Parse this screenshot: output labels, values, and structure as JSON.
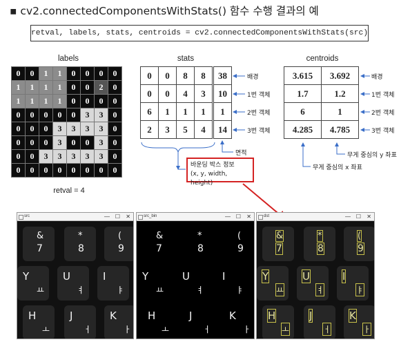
{
  "title": "▪ cv2.connectedComponentsWithStats() 함수 수행 결과의 예",
  "code": "retval, labels, stats, centroids = cv2.connectedComponentsWithStats(src)",
  "labels_caption": "labels",
  "labels_grid": [
    [
      0,
      0,
      1,
      1,
      0,
      0,
      0,
      0
    ],
    [
      1,
      1,
      1,
      1,
      0,
      0,
      2,
      0
    ],
    [
      1,
      1,
      1,
      1,
      0,
      0,
      0,
      0
    ],
    [
      0,
      0,
      0,
      0,
      0,
      3,
      3,
      0
    ],
    [
      0,
      0,
      0,
      3,
      3,
      3,
      3,
      0
    ],
    [
      0,
      0,
      0,
      3,
      0,
      0,
      3,
      0
    ],
    [
      0,
      0,
      3,
      3,
      3,
      3,
      3,
      0
    ],
    [
      0,
      0,
      0,
      0,
      0,
      0,
      0,
      0
    ]
  ],
  "retval_text": "retval = 4",
  "stats_caption": "stats",
  "stats_rows": [
    [
      "0",
      "0",
      "8",
      "8",
      "38"
    ],
    [
      "0",
      "0",
      "4",
      "3",
      "10"
    ],
    [
      "6",
      "1",
      "1",
      "1",
      "1"
    ],
    [
      "2",
      "3",
      "5",
      "4",
      "14"
    ]
  ],
  "stats_row_labels": [
    "배경",
    "1번 객체",
    "2번 객체",
    "3번 객체"
  ],
  "area_label": "면적",
  "bbox_label_line1": "바운딩 박스 정보",
  "bbox_label_line2": "(x, y, width, height)",
  "centroids_caption": "centroids",
  "centroid_rows": [
    [
      "3.615",
      "3.692"
    ],
    [
      "1.7",
      "1.2"
    ],
    [
      "6",
      "1"
    ],
    [
      "4.285",
      "4.785"
    ]
  ],
  "centroid_row_labels": [
    "배경",
    "1번 객체",
    "2번 객체",
    "3번 객체"
  ],
  "centroid_y_label": "무게 중심의 y 좌표",
  "centroid_x_label": "무게 중심의 x 좌표",
  "windows": [
    {
      "title": "src"
    },
    {
      "title": "src_bin"
    },
    {
      "title": "dst"
    }
  ],
  "window_buttons": [
    "—",
    "☐",
    "✕"
  ],
  "keys": [
    {
      "main": "&",
      "sub": "7"
    },
    {
      "main": "*",
      "sub": "8"
    },
    {
      "main": "(",
      "sub": "9"
    },
    {
      "main": "Y",
      "sub": "ㅛ"
    },
    {
      "main": "U",
      "sub": "ㅕ"
    },
    {
      "main": "I",
      "sub": "ㅑ"
    },
    {
      "main": "H",
      "sub": "ㅗ"
    },
    {
      "main": "J",
      "sub": "ㅓ"
    },
    {
      "main": "K",
      "sub": "ㅏ"
    }
  ],
  "colors": {
    "highlight_red": "#d42222",
    "label_bg_dark": "#0d0d0d",
    "label_bg_1": "#8c8c8c",
    "label_bg_2": "#555555",
    "label_bg_3": "#d9d9d9"
  }
}
